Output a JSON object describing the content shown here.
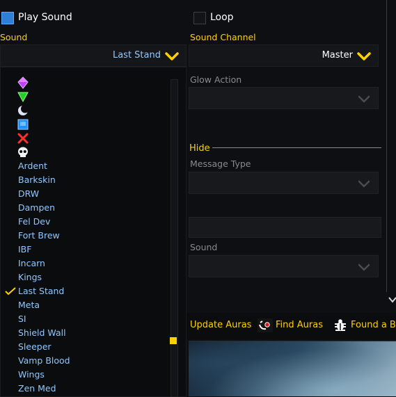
{
  "left_panel": {
    "play_sound_label": "Play Sound",
    "sound_label": "Sound",
    "sound_selected": "Last Stand",
    "sound_options": [
      "Ardent",
      "Barkskin",
      "DRW",
      "Dampen",
      "Fel Dev",
      "Fort Brew",
      "IBF",
      "Incarn",
      "Kings",
      "Last Stand",
      "Meta",
      "SI",
      "Shield Wall",
      "Sleeper",
      "Vamp Blood",
      "Wings",
      "Zen Med"
    ],
    "checked_index": 9
  },
  "right_panel": {
    "loop_label": "Loop",
    "sound_channel_label": "Sound Channel",
    "sound_channel_value": "Master",
    "glow_action_label": "Glow Action",
    "hide_header": "Hide",
    "message_type_label": "Message Type",
    "sound_label": "Sound"
  },
  "toolbar": {
    "update_auras": "Update Auras",
    "find_auras": "Find Auras",
    "found_bug": "Found a Bu"
  },
  "colors": {
    "gold": "#ffd100",
    "option_blue": "#8fc8ff",
    "checkbox_blue": "#2f7fd6"
  },
  "icons": [
    "purple-gem-icon",
    "green-triangle-icon",
    "moon-icon",
    "blue-square-icon",
    "red-cross-icon",
    "skull-icon"
  ]
}
